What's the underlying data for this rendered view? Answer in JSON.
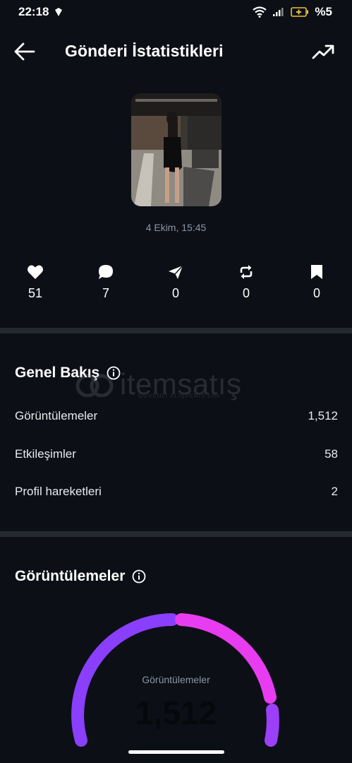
{
  "status_bar": {
    "time": "22:18",
    "battery_text": "%5",
    "icons": [
      "shield-icon",
      "wifi-icon",
      "signal-icon",
      "battery-charging-icon"
    ]
  },
  "header": {
    "title": "Gönderi İstatistikleri",
    "back_icon": "arrow-left-icon",
    "action_icon": "trending-up-icon"
  },
  "post": {
    "date": "4 Ekim, 15:45"
  },
  "metrics": [
    {
      "icon": "heart-icon",
      "value": "51"
    },
    {
      "icon": "comment-icon",
      "value": "7"
    },
    {
      "icon": "share-icon",
      "value": "0"
    },
    {
      "icon": "repost-icon",
      "value": "0"
    },
    {
      "icon": "bookmark-icon",
      "value": "0"
    }
  ],
  "overview": {
    "title": "Genel Bakış",
    "rows": [
      {
        "label": "Görüntülemeler",
        "value": "1,512"
      },
      {
        "label": "Etkileşimler",
        "value": "58"
      },
      {
        "label": "Profil hareketleri",
        "value": "2"
      }
    ]
  },
  "watermark": {
    "text": "itemsatış",
    "small": "GÜVENLİ ALIŞVERİŞ.com"
  },
  "views_section": {
    "title": "Görüntülemeler",
    "gauge_label": "Görüntülemeler",
    "gauge_value": "1,512"
  },
  "colors": {
    "background": "#0c0f16",
    "divider": "#24292f",
    "gauge_purple": "#8a3ffc",
    "gauge_pink": "#e83cf0"
  }
}
